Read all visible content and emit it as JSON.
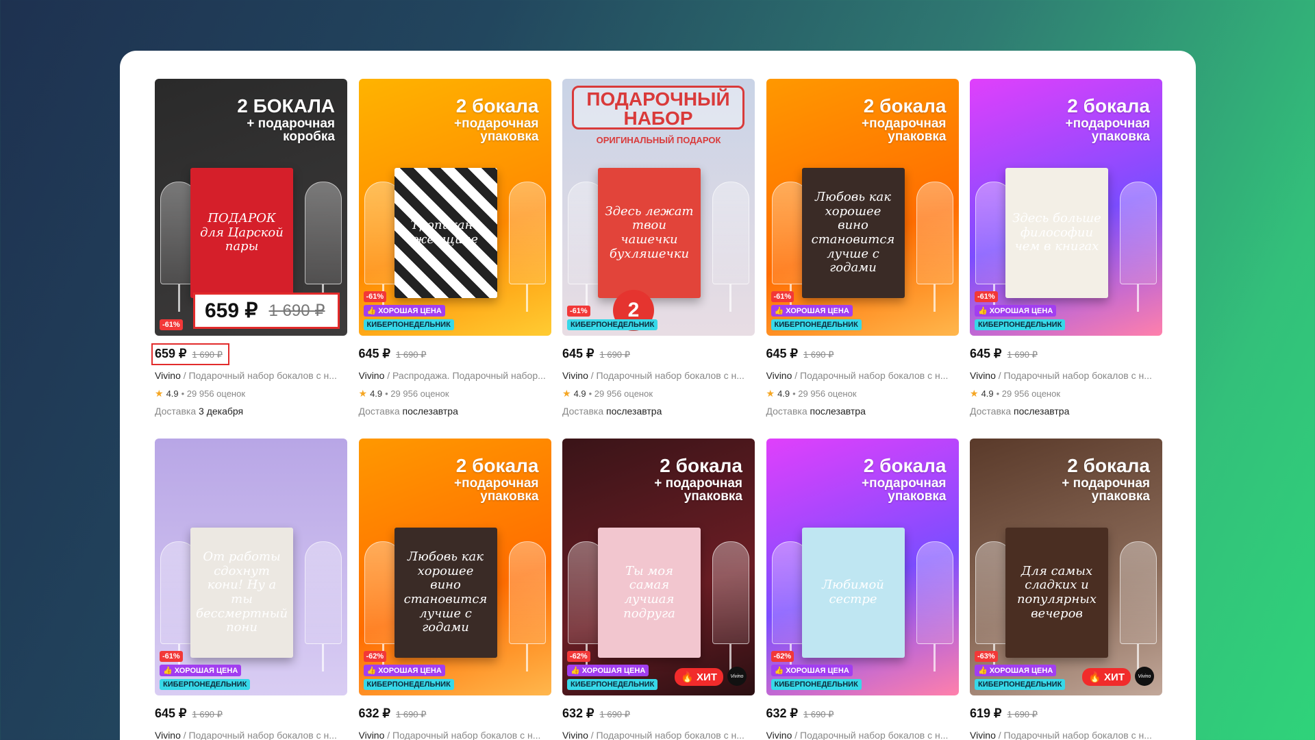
{
  "products": [
    {
      "headline": [
        "2 БОКАЛА",
        "+ подарочная",
        "коробка"
      ],
      "box_text": "ПОДАРОК для Царской пары",
      "bg": "linear-gradient(160deg,#2a2a2a,#3d3b3b)",
      "box_bg": "#d51f2a",
      "discount": "-61%",
      "good_price": "",
      "cyber": "",
      "hit": "",
      "overlay_price": "659 ₽",
      "overlay_old": "1 690 ₽",
      "price": "659 ₽",
      "old_price": "1 690 ₽",
      "seller": "Vivino",
      "title": " / Подарочный набор бокалов с н...",
      "rating": "4.9",
      "reviews": "• 29 956 оценок",
      "delivery_label": "Доставка",
      "delivery_date": "3 декабря"
    },
    {
      "headline": [
        "2 бокала",
        "+подарочная",
        "упаковка"
      ],
      "box_text": "Тропикано женщине",
      "bg": "linear-gradient(160deg,#ffb300,#ff8a00 60%,#ffcc33)",
      "box_bg": "repeating-linear-gradient(45deg,#222 0 14px,#fff 14px 28px)",
      "discount": "-61%",
      "good_price": "ХОРОШАЯ ЦЕНА",
      "cyber": "КИБЕРПОНЕДЕЛЬНИК",
      "hit": "",
      "price": "645 ₽",
      "old_price": "1 690 ₽",
      "seller": "Vivino",
      "title": " / Распродажа. Подарочный набор...",
      "rating": "4.9",
      "reviews": "• 29 956 оценок",
      "delivery_label": "Доставка",
      "delivery_date": "послезавтра"
    },
    {
      "headline": [
        "ПОДАРОЧНЫЙ",
        "НАБОР",
        "ОРИГИНАЛЬНЫЙ ПОДАРОК"
      ],
      "box_text": "Здесь лежат твои чашечки бухляшечки",
      "bg": "linear-gradient(180deg,#c9d3e6,#e8dde4)",
      "box_bg": "#e2443a",
      "discount": "-61%",
      "good_price": "",
      "cyber": "КИБЕРПОНЕДЕЛЬНИК",
      "hit": "",
      "badge_number": "2",
      "price": "645 ₽",
      "old_price": "1 690 ₽",
      "seller": "Vivino",
      "title": " / Подарочный набор бокалов с н...",
      "rating": "4.9",
      "reviews": "• 29 956 оценок",
      "delivery_label": "Доставка",
      "delivery_date": "послезавтра"
    },
    {
      "headline": [
        "2 бокала",
        "+подарочная",
        "упаковка"
      ],
      "box_text": "Любовь как хорошее вино становится лучше с годами",
      "bg": "linear-gradient(160deg,#ff9800,#ff6d00 60%,#ffb74d)",
      "box_bg": "#3a2b26",
      "discount": "-61%",
      "good_price": "ХОРОШАЯ ЦЕНА",
      "cyber": "КИБЕРПОНЕДЕЛЬНИК",
      "hit": "",
      "price": "645 ₽",
      "old_price": "1 690 ₽",
      "seller": "Vivino",
      "title": " / Подарочный набор бокалов с н...",
      "rating": "4.9",
      "reviews": "• 29 956 оценок",
      "delivery_label": "Доставка",
      "delivery_date": "послезавтра"
    },
    {
      "headline": [
        "2 бокала",
        "+подарочная",
        "упаковка"
      ],
      "box_text": "Здесь больше философии чем в книгах",
      "bg": "linear-gradient(160deg,#e040fb,#7c4dff 55%,#ff80ab)",
      "box_bg": "#f3efe6",
      "discount": "-61%",
      "good_price": "ХОРОШАЯ ЦЕНА",
      "cyber": "КИБЕРПОНЕДЕЛЬНИК",
      "hit": "",
      "price": "645 ₽",
      "old_price": "1 690 ₽",
      "seller": "Vivino",
      "title": " / Подарочный набор бокалов с н...",
      "rating": "4.9",
      "reviews": "• 29 956 оценок",
      "delivery_label": "Доставка",
      "delivery_date": "послезавтра"
    },
    {
      "headline": [
        "",
        "",
        ""
      ],
      "box_text": "От работы сдохнут кони! Ну а ты бессмертный пони",
      "bg": "linear-gradient(180deg,#b8a6e6,#d9cdf3)",
      "box_bg": "#ece8e2",
      "discount": "-61%",
      "good_price": "ХОРОШАЯ ЦЕНА",
      "cyber": "КИБЕРПОНЕДЕЛЬНИК",
      "hit": "",
      "price": "645 ₽",
      "old_price": "1 690 ₽",
      "seller": "Vivino",
      "title": " / Подарочный набор бокалов с н...",
      "rating": "",
      "reviews": "",
      "delivery_label": "",
      "delivery_date": ""
    },
    {
      "headline": [
        "2 бокала",
        "+подарочная",
        "упаковка"
      ],
      "box_text": "Любовь как хорошее вино становится лучше с годами",
      "bg": "linear-gradient(160deg,#ff9800,#ff6d00 60%,#ffb74d)",
      "box_bg": "#3a2b26",
      "discount": "-62%",
      "good_price": "ХОРОШАЯ ЦЕНА",
      "cyber": "КИБЕРПОНЕДЕЛЬНИК",
      "hit": "",
      "price": "632 ₽",
      "old_price": "1 690 ₽",
      "seller": "Vivino",
      "title": " / Подарочный набор бокалов с н...",
      "rating": "",
      "reviews": "",
      "delivery_label": "",
      "delivery_date": ""
    },
    {
      "headline": [
        "2 бокала",
        "+ подарочная",
        "упаковка"
      ],
      "box_text": "Ты моя самая лучшая подруга",
      "bg": "linear-gradient(160deg,#3a1418,#6a1d24 60%,#2a0f12)",
      "box_bg": "#f2c6cf",
      "discount": "-62%",
      "good_price": "ХОРОШАЯ ЦЕНА",
      "cyber": "КИБЕРПОНЕДЕЛЬНИК",
      "hit": "🔥 ХИТ",
      "brand_mark": "Vivino",
      "price": "632 ₽",
      "old_price": "1 690 ₽",
      "seller": "Vivino",
      "title": " / Подарочный набор бокалов с н...",
      "rating": "",
      "reviews": "",
      "delivery_label": "",
      "delivery_date": ""
    },
    {
      "headline": [
        "2 бокала",
        "+подарочная",
        "упаковка"
      ],
      "box_text": "Любимой сестре",
      "bg": "linear-gradient(160deg,#e040fb,#7c4dff 55%,#ff80ab)",
      "box_bg": "#bfe6f2",
      "discount": "-62%",
      "good_price": "ХОРОШАЯ ЦЕНА",
      "cyber": "КИБЕРПОНЕДЕЛЬНИК",
      "hit": "",
      "price": "632 ₽",
      "old_price": "1 690 ₽",
      "seller": "Vivino",
      "title": " / Подарочный набор бокалов с н...",
      "rating": "",
      "reviews": "",
      "delivery_label": "",
      "delivery_date": ""
    },
    {
      "headline": [
        "2 бокала",
        "+ подарочная",
        "упаковка"
      ],
      "box_text": "Для самых сладких и популярных вечеров",
      "bg": "linear-gradient(160deg,#5a3a2a,#8a6a58 60%,#c2a89a)",
      "box_bg": "#4a2e22",
      "discount": "-63%",
      "good_price": "ХОРОШАЯ ЦЕНА",
      "cyber": "КИБЕРПОНЕДЕЛЬНИК",
      "hit": "🔥 ХИТ",
      "brand_mark": "Vivino",
      "price": "619 ₽",
      "old_price": "1 690 ₽",
      "seller": "Vivino",
      "title": " / Подарочный набор бокалов с н...",
      "rating": "",
      "reviews": "",
      "delivery_label": "",
      "delivery_date": ""
    }
  ]
}
